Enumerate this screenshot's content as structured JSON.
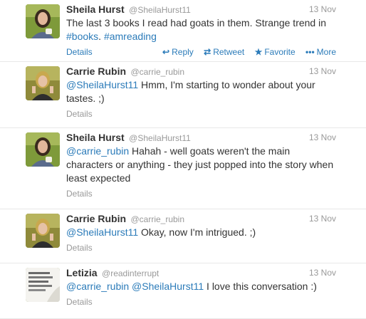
{
  "tweets": [
    {
      "fullname": "Sheila Hurst",
      "username": "@SheilaHurst11",
      "time": "13 Nov",
      "text_before": "The last 3 books I read had goats in them. Strange trend in ",
      "tag1": "#books",
      "text_mid": ". ",
      "tag2": "#amreading",
      "details": "Details",
      "actions": {
        "reply": "Reply",
        "retweet": "Retweet",
        "favorite": "Favorite",
        "more": "More"
      }
    },
    {
      "fullname": "Carrie Rubin",
      "username": "@carrie_rubin",
      "time": "13 Nov",
      "mention": "@SheilaHurst11",
      "text": " Hmm, I'm starting to wonder about your tastes. ;)",
      "details": "Details"
    },
    {
      "fullname": "Sheila Hurst",
      "username": "@SheilaHurst11",
      "time": "13 Nov",
      "mention": "@carrie_rubin",
      "text": " Hahah - well goats weren't the main characters or anything - they just popped into the story when least expected",
      "details": "Details"
    },
    {
      "fullname": "Carrie Rubin",
      "username": "@carrie_rubin",
      "time": "13 Nov",
      "mention": "@SheilaHurst11",
      "text": " Okay, now I'm intrigued. ;)",
      "details": "Details"
    },
    {
      "fullname": "Letizia",
      "username": "@readinterrupt",
      "time": "13 Nov",
      "mention1": "@carrie_rubin",
      "mention2": "@SheilaHurst11",
      "text": " I love this conversation :)",
      "details": "Details"
    }
  ],
  "colors": {
    "link": "#2b7bb9",
    "muted": "#999999",
    "text": "#333333"
  }
}
